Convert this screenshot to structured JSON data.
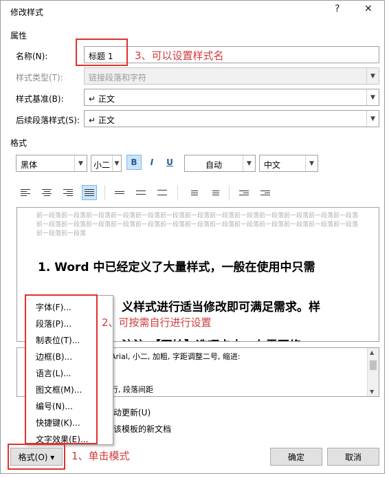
{
  "dialog": {
    "title": "修改样式",
    "help_btn": "?",
    "close_btn": "✕",
    "section_props": "属性",
    "section_format": "格式"
  },
  "props": {
    "name_label": "名称(N):",
    "name_value": "标题 1",
    "style_type_label": "样式类型(T):",
    "style_type_value": "链接段落和字符",
    "style_based_label": "样式基准(B):",
    "style_based_value": "↵ 正文",
    "next_style_label": "后续段落样式(S):",
    "next_style_value": "↵ 正文"
  },
  "format": {
    "font": "黑体",
    "size": "小二",
    "bold": "B",
    "italic": "I",
    "underline": "U",
    "color": "自动",
    "lang": "中文"
  },
  "preview": {
    "prev_para": "前一段落前一段落前一段落前一段落前一段落前一段落前一段落前一段落前一段落前一段落前一段落前一段落前一段落前一段落前一段落前一段落前一段落前一段落前一段落前一段落前一段落前一段落前一段落前一段落前一段落前一段落前一段落前一段落",
    "line1": "1. Word 中已经定义了大量样式，一般在使用中只需",
    "line2": "义样式进行适当修改即可满足需求。样",
    "line3": "注注        【开始】选项卡中，在需要修"
  },
  "description": {
    "line1": "Arial, 小二, 加粗, 字距调整二号, 缩进:",
    "line2": "行, 段落间距"
  },
  "options": {
    "auto_update": "动更新(U)",
    "new_docs": "该模板的新文档"
  },
  "menu": {
    "items": [
      "字体(F)...",
      "段落(P)...",
      "制表位(T)...",
      "边框(B)...",
      "语言(L)...",
      "图文框(M)...",
      "编号(N)...",
      "快捷键(K)...",
      "文字效果(E)..."
    ]
  },
  "buttons": {
    "format": "格式(O) ▾",
    "ok": "确定",
    "cancel": "取消"
  },
  "annotations": {
    "a1": "1、单击模式",
    "a2": "2、可按需自行进行设置",
    "a3": "3、可以设置样式名"
  },
  "colors": {
    "annotation": "#d23a3a",
    "selection": "#cce4f7"
  }
}
